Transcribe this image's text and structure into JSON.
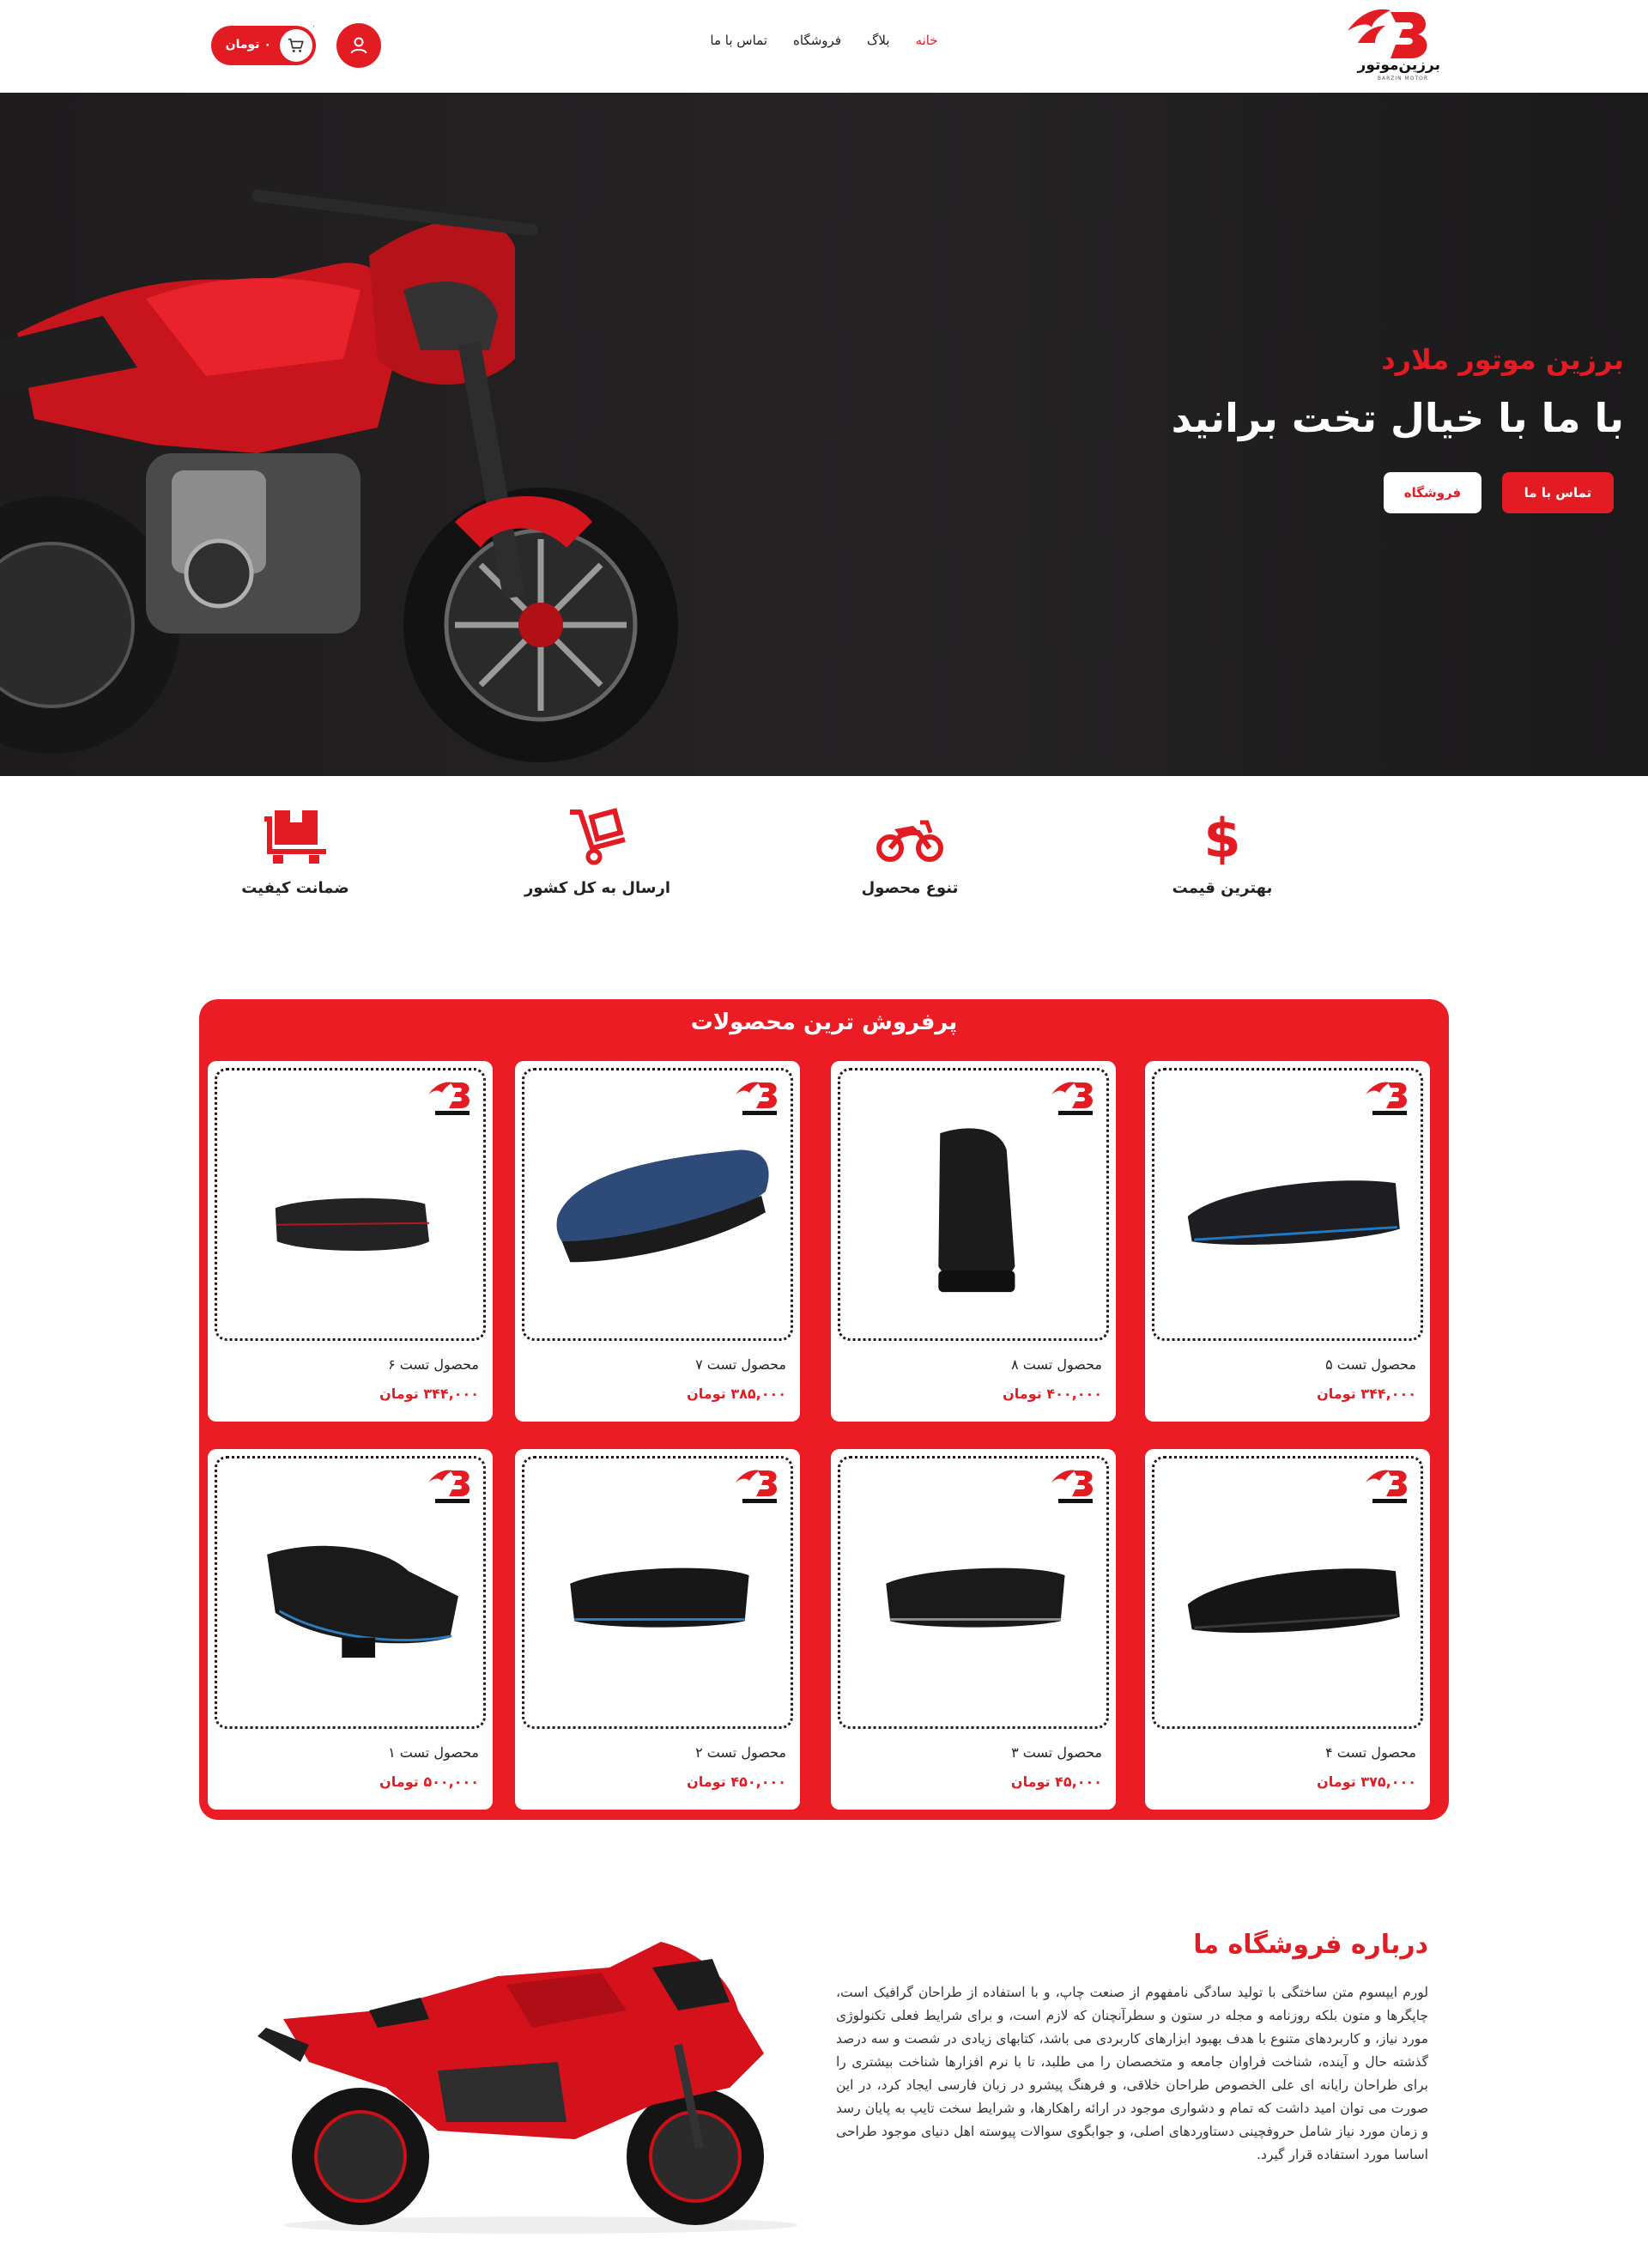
{
  "header": {
    "logo_text": "برزین‌موتور",
    "logo_sub": "BARZIN MOTOR",
    "nav": [
      {
        "label": "خانه",
        "active": true
      },
      {
        "label": "بلاگ",
        "active": false
      },
      {
        "label": "فروشگاه",
        "active": false
      },
      {
        "label": "تماس با ما",
        "active": false
      }
    ],
    "cart_price": "۰ تومان",
    "cart_count": "۰"
  },
  "hero": {
    "subtitle": "برزین موتور ملارد",
    "title": "با ما با خیال تخت برانید",
    "btn_contact": "تماس با ما",
    "btn_shop": "فروشگاه"
  },
  "features": [
    {
      "title": "بهترین قیمت",
      "icon": "dollar-icon"
    },
    {
      "title": "تنوع محصول",
      "icon": "motorcycle-icon"
    },
    {
      "title": "ارسال به کل کشور",
      "icon": "hand-truck-icon"
    },
    {
      "title": "ضمانت کیفیت",
      "icon": "pallet-box-icon"
    }
  ],
  "bestsellers": {
    "title": "پرفروش ترین محصولات",
    "products": [
      {
        "name": "محصول تست ۵",
        "price": "۳۴۴,۰۰۰ تومان"
      },
      {
        "name": "محصول تست ۸",
        "price": "۴۰۰,۰۰۰ تومان"
      },
      {
        "name": "محصول تست ۷",
        "price": "۳۸۵,۰۰۰ تومان"
      },
      {
        "name": "محصول تست ۶",
        "price": "۳۴۴,۰۰۰ تومان"
      },
      {
        "name": "محصول تست ۴",
        "price": "۳۷۵,۰۰۰ تومان"
      },
      {
        "name": "محصول تست ۳",
        "price": "۴۵,۰۰۰ تومان"
      },
      {
        "name": "محصول تست ۲",
        "price": "۴۵۰,۰۰۰ تومان"
      },
      {
        "name": "محصول تست ۱",
        "price": "۵۰۰,۰۰۰ تومان"
      }
    ]
  },
  "about": {
    "title": "درباره فروشگاه ما",
    "text": "لورم ایپسوم متن ساختگی با تولید سادگی نامفهوم از صنعت چاپ، و با استفاده از طراحان گرافیک است، چاپگرها و متون بلکه روزنامه و مجله در ستون و سطرآنچنان که لازم است، و برای شرایط فعلی تکنولوژی مورد نیاز، و کاربردهای متنوع با هدف بهبود ابزارهای کاربردی می باشد، کتابهای زیادی در شصت و سه درصد گذشته حال و آینده، شناخت فراوان جامعه و متخصصان را می طلبد، تا با نرم افزارها شناخت بیشتری را برای طراحان رایانه ای علی الخصوص طراحان خلاقی، و فرهنگ پیشرو در زبان فارسی ایجاد کرد، در این صورت می توان امید داشت که تمام و دشواری موجود در ارائه راهکارها، و شرایط سخت تایپ به پایان رسد و زمان مورد نیاز شامل حروفچینی دستاوردهای اصلی، و جوابگوی سوالات پیوسته اهل دنیای موجود طراحی اساسا مورد استفاده قرار گیرد."
  },
  "colors": {
    "accent": "#e31b23",
    "hero_bg": "#231f20"
  }
}
